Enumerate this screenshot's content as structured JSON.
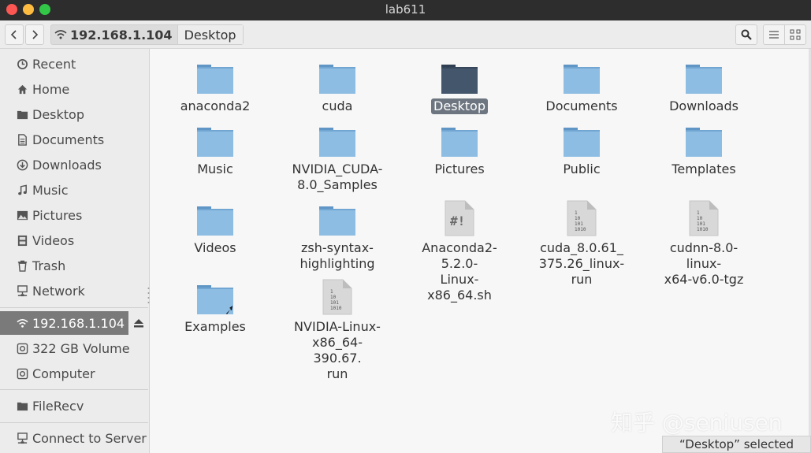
{
  "window": {
    "title": "lab611"
  },
  "toolbar": {
    "path": [
      {
        "label": "192.168.1.104",
        "icon": "wifi-icon"
      },
      {
        "label": "Desktop"
      }
    ]
  },
  "sidebar": {
    "places": [
      {
        "label": "Recent",
        "icon": "clock-icon"
      },
      {
        "label": "Home",
        "icon": "home-icon"
      },
      {
        "label": "Desktop",
        "icon": "folder-icon"
      },
      {
        "label": "Documents",
        "icon": "document-icon"
      },
      {
        "label": "Downloads",
        "icon": "download-icon"
      },
      {
        "label": "Music",
        "icon": "music-icon"
      },
      {
        "label": "Pictures",
        "icon": "picture-icon"
      },
      {
        "label": "Videos",
        "icon": "video-icon"
      },
      {
        "label": "Trash",
        "icon": "trash-icon"
      },
      {
        "label": "Network",
        "icon": "network-icon"
      }
    ],
    "devices": [
      {
        "label": "192.168.1.104",
        "icon": "wifi-icon",
        "active": true
      },
      {
        "label": "322 GB Volume",
        "icon": "drive-icon"
      },
      {
        "label": "Computer",
        "icon": "drive-icon"
      }
    ],
    "bookmarks": [
      {
        "label": "FileRecv",
        "icon": "folder-icon"
      }
    ],
    "other": [
      {
        "label": "Connect to Server",
        "icon": "server-icon"
      }
    ]
  },
  "files": [
    {
      "name": "anaconda2",
      "type": "folder"
    },
    {
      "name": "cuda",
      "type": "folder"
    },
    {
      "name": "Desktop",
      "type": "folder",
      "selected": true
    },
    {
      "name": "Documents",
      "type": "folder"
    },
    {
      "name": "Downloads",
      "type": "folder"
    },
    {
      "name": "Music",
      "type": "folder"
    },
    {
      "name": "NVIDIA_CUDA-\n8.0_Samples",
      "type": "folder"
    },
    {
      "name": "Pictures",
      "type": "folder"
    },
    {
      "name": "Public",
      "type": "folder"
    },
    {
      "name": "Templates",
      "type": "folder"
    },
    {
      "name": "Videos",
      "type": "folder"
    },
    {
      "name": "zsh-syntax-\nhighlighting",
      "type": "folder"
    },
    {
      "name": "Anaconda2-5.2.0-\nLinux-x86_64.sh",
      "type": "script"
    },
    {
      "name": "cuda_8.0.61_\n375.26_linux-run",
      "type": "binary"
    },
    {
      "name": "cudnn-8.0-linux-\nx64-v6.0-tgz",
      "type": "binary"
    },
    {
      "name": "Examples",
      "type": "folder-link"
    },
    {
      "name": "NVIDIA-Linux-\nx86_64-390.67.\nrun",
      "type": "binary"
    }
  ],
  "status": {
    "text": "“Desktop” selected"
  },
  "watermark": {
    "text": "知乎 @seniusen"
  },
  "colors": {
    "folder": "#8ebde3",
    "folder_tab": "#5f96c6",
    "folder_selected": "#44566b",
    "selection": "#6d7680",
    "sidebar_active": "#7a7a7a"
  }
}
